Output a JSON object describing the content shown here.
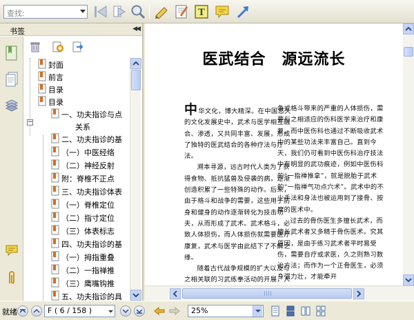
{
  "toolbar": {
    "search_placeholder": "查找:"
  },
  "panel": {
    "title": "书签"
  },
  "bookmarks": [
    {
      "label": "封面"
    },
    {
      "label": "前言"
    },
    {
      "label": "目录"
    },
    {
      "label": "目录"
    },
    {
      "label": "一、功夫指诊与点"
    },
    {
      "label": "关系"
    },
    {
      "label": "二、功夫指诊的基"
    },
    {
      "label": "（一）中医经络"
    },
    {
      "label": "（二）神经反射"
    },
    {
      "label": "附：脊椎不正点"
    },
    {
      "label": "三、功夫指诊体表"
    },
    {
      "label": "（一）脊椎定位"
    },
    {
      "label": "（二）指寸定位"
    },
    {
      "label": "（三）体表标志"
    },
    {
      "label": "四、功夫指诊的基"
    },
    {
      "label": "（一）拇指重叠"
    },
    {
      "label": "（二）一指禅推"
    },
    {
      "label": "（三）鹰嘴钩推"
    },
    {
      "label": "五、功夫指诊的具"
    }
  ],
  "document": {
    "title": "医武结合　源远流长",
    "dropcap": "中",
    "col1": [
      "华文化，博大精深。在中国悠久的文化发展史中，武术与医学相互融合、渗透，又共同丰富、发展，形成了独特的医武结合的各种疗法与疗法。",
      "溯本寻源，远古时代人类为了获得食物、抵抗猛兽及侵袭的病，逐渐创造积累了一些特殊的动作。后来，由于格斗和战争的需要，这些用于防身和健身的动作逐渐转化为技击功夫，从而形成了武术。武术格斗，必致人体损伤，而人体损伤就需要医疗康复，武术与医学由此结下了不解之缘。",
      "随着古代战争规模的扩大以及与之相关联的习武练拳活动的开展，人体的各种损伤，包括伤"
    ],
    "col2": [
      "争或格斗带来的严重的人体损伤，需要与之相适应的伤科医学来治疗和康复，而中医伤科也通过不断吸收武术中的某些功法来丰富自己。直到今天，我们仍可看到中医伤科治疗技法中有明显的武功痕迹，例如中医伤科的“一指禅推拿”，就是脱胎于武术的“一指禅气功点穴术”。武术中的不少手法和身法也被运用到了接骨、按摩的医术中。",
      "过去的骨伤医生多擅长武术，而擅长武术者又多精于骨伤医术。究其原因，是由于练习武术者平时易受伤，需要自疗或求医，久之则熟习数治方法；而作为一个正骨医生，必须身强力壮，才能牵开"
    ]
  },
  "status": {
    "label": "就绪",
    "page_text": "F ( 6 / 158 )",
    "zoom": "25%"
  },
  "colors": {
    "accent_blue": "#3b7bd4",
    "bookmark_orange": "#d76b1a"
  }
}
